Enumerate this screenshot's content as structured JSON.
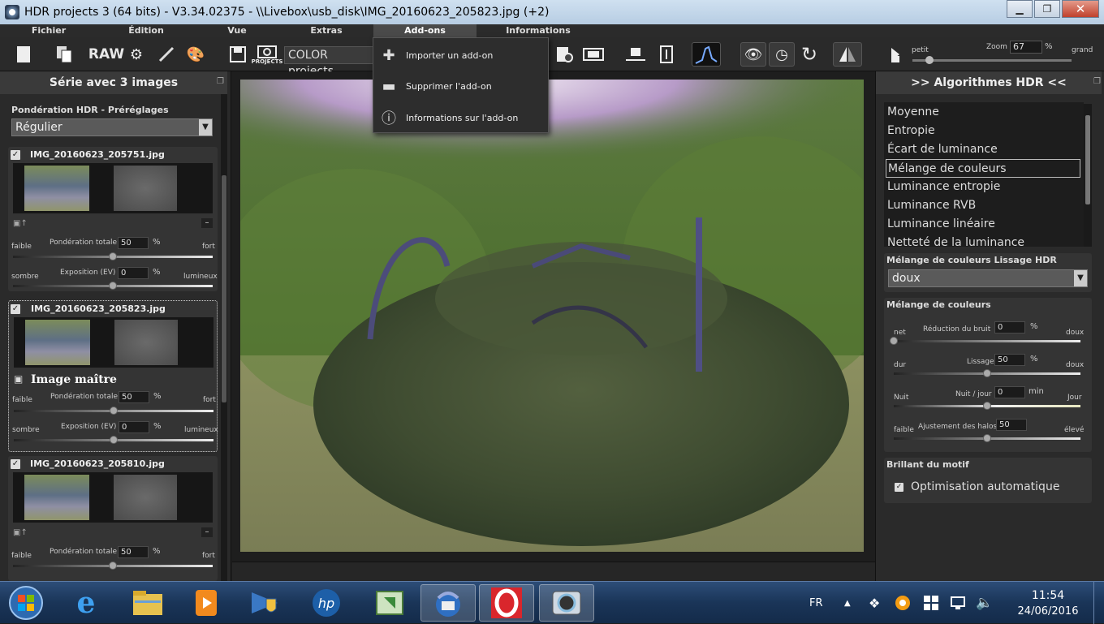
{
  "window": {
    "title": "HDR projects 3 (64 bits) - V3.34.02375 - \\\\Livebox\\usb_disk\\IMG_20160623_205823.jpg (+2)"
  },
  "menu": {
    "items": [
      "Fichier",
      "Édition",
      "Vue",
      "Extras",
      "Add-ons",
      "Informations"
    ]
  },
  "toolbar": {
    "raw_label": "RAW",
    "projects_label": "PROJECTS",
    "preset_combo": "COLOR projects",
    "zoom": {
      "small": "petit",
      "label": "Zoom",
      "value": "67",
      "unit": "%",
      "large": "grand",
      "level": 0.08
    }
  },
  "addons_menu": {
    "items": [
      {
        "label": "Importer un add-on",
        "icon": "plugin-add-icon"
      },
      {
        "label": "Supprimer l'add-on",
        "icon": "plugin-remove-icon"
      },
      {
        "label": "Informations sur l'add-on",
        "icon": "plugin-info-icon"
      }
    ]
  },
  "left_panel": {
    "title": "Série avec 3 images",
    "preset_section_title": "Pondération HDR - Préréglages",
    "preset_value": "Régulier",
    "images": [
      {
        "name": "IMG_20160623_205751.jpg",
        "weight_low": "faible",
        "weight_label": "Pondération totale",
        "weight_value": "50",
        "unit": "%",
        "weight_high": "fort",
        "exp_low": "sombre",
        "exp_label": "Exposition (EV)",
        "exp_value": "0",
        "exp_high": "lumineux",
        "minus": "–"
      },
      {
        "name": "IMG_20160623_205823.jpg",
        "master": "Image maître",
        "weight_low": "faible",
        "weight_label": "Pondération totale",
        "weight_value": "50",
        "unit": "%",
        "weight_high": "fort",
        "exp_low": "sombre",
        "exp_label": "Exposition (EV)",
        "exp_value": "0",
        "exp_high": "lumineux"
      },
      {
        "name": "IMG_20160623_205810.jpg",
        "weight_low": "faible",
        "weight_label": "Pondération totale",
        "weight_value": "50",
        "unit": "%",
        "weight_high": "fort",
        "minus": "–"
      }
    ]
  },
  "right_panel": {
    "title": ">> Algorithmes HDR <<",
    "algorithms": [
      "Moyenne",
      "Entropie",
      "Écart de luminance",
      "Mélange de couleurs",
      "Luminance entropie",
      "Luminance RVB",
      "Luminance linéaire",
      "Netteté de la luminance"
    ],
    "selected_algorithm": "Mélange de couleurs",
    "smoothing_title": "Mélange de couleurs Lissage HDR",
    "smoothing_value": "doux",
    "mix_title": "Mélange de couleurs",
    "sliders": [
      {
        "low": "net",
        "label": "Réduction du bruit",
        "value": "0",
        "unit": "%",
        "high": "doux",
        "level": 0.0
      },
      {
        "low": "dur",
        "label": "Lissage",
        "value": "50",
        "unit": "%",
        "high": "doux",
        "level": 0.5
      },
      {
        "low": "Nuit",
        "label": "Nuit / jour",
        "value": "0",
        "unit": "min",
        "high": "Jour",
        "level": 0.5
      },
      {
        "low": "faible",
        "label": "Ajustement des halos",
        "value": "50",
        "unit": "",
        "high": "élevé",
        "level": 0.5
      }
    ],
    "brilliance_title": "Brillant du motif",
    "auto_opt_label": "Optimisation automatique"
  },
  "taskbar": {
    "lang": "FR",
    "time": "11:54",
    "date": "24/06/2016",
    "apps": [
      "start-orb",
      "ie-icon",
      "explorer-icon",
      "media-player-icon",
      "control-panel-icon",
      "hp-icon",
      "sync-icon",
      "thunderbird-icon",
      "opera-icon",
      "hdr-projects-icon"
    ]
  }
}
